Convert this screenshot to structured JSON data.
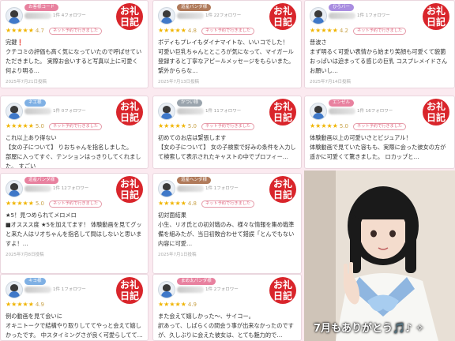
{
  "cards": [
    {
      "badge": "お客様コード",
      "seal_top": "お礼",
      "seal_bottom": "日記",
      "meta": "1件 4フォロワー",
      "rating_num": "4.7",
      "tag": "ネット予約で行きました",
      "body": "完鍵❗️\nクチコミの評価も高く気になっていたので呼ばせていただきました。 実際お会いすると写真以上に可愛く何より明る…",
      "date": "2025年7月21日投稿"
    },
    {
      "badge": "道産パンダ様",
      "seal_top": "お礼",
      "seal_bottom": "日記",
      "meta": "1件 22フォロワー",
      "rating_num": "4.8",
      "tag": "ネット予約で行きました",
      "body": "ボディもプレイもダイナマイトな、いいコでした！\n可愛い巨乳ちゃんとところが気になって、マイガール登録すると丁寧なアピールメッセージをもらいまた。緊外かららな…",
      "date": "2025年7月13日投稿"
    },
    {
      "badge": "ひろバー",
      "seal_top": "お礼",
      "seal_bottom": "日記",
      "meta": "1件 1フォロワー",
      "rating_num": "4.2",
      "tag": "ネット予約で行きました",
      "body": "普波さ\nまず明るく可愛い表情から始まり笑顔も可愛くて貌菌 おっぱいは迫まってる感じの巨乳 コスプレメイドさんお願いし…",
      "date": "2025年7月14日投稿"
    },
    {
      "badge": "ネエ様",
      "seal_top": "お礼",
      "seal_bottom": "日記",
      "meta": "1件 0フォロワー",
      "rating_num": "5.0",
      "tag": "ネット予約で行きました",
      "body": "これ以上あり得ない\n【女の子について】 りおちゃんを指名しました。\n部屋に入ってすぐ、テンションはっきりしてくれました。 すごい",
      "date": ""
    },
    {
      "badge": "かつい様",
      "seal_top": "お礼",
      "seal_bottom": "日記",
      "meta": "1件 11フォロワー",
      "rating_num": "5.0",
      "tag": "ネット予約で行きました",
      "body": "初めてのお店は緊張します\n【女の子について】 女の子検索で好みの条件を入力して検索して表示されたキャストの中でプロフィー…",
      "date": ""
    },
    {
      "badge": "エンゼル",
      "seal_top": "お礼",
      "seal_bottom": "日記",
      "meta": "1件 16フォロワー",
      "rating_num": "5.0",
      "tag": "ネット予約で行きました",
      "body": "体験動画以上の可愛いさとビジュアル！\n体験動画で見ていた容もも、実際に会った彼女の方が遥かに可愛くて驚きました。 ロカップと…",
      "date": ""
    },
    {
      "badge": "道産パンダ様",
      "seal_top": "お礼",
      "seal_bottom": "日記",
      "meta": "1件 12フォロワー",
      "rating_num": "5.0",
      "tag": "ネット予約で行きました",
      "body": "★5！見つめられてメロメロ\n■オススス度 ★5を加えてます！ 体験動画を見てグッと来た人はリオちゃんを指名して間はしないと思いますよ！…",
      "date": "2025年7月8日投稿"
    },
    {
      "badge": "道産ヘンダ様",
      "seal_top": "お礼",
      "seal_bottom": "日記",
      "meta": "1件 1フォロワー",
      "rating_num": "4.8",
      "tag": "ネット予約で行きました",
      "body": "初対面結果\n小生、リオ氏との初対戦のみ、様々な情報を集め戦準備を組みたが、当日初敗合わせて錯誤「とんでもない内容に可愛…",
      "date": "2025年7月1日投稿"
    },
    {
      "badge": "キヨ様",
      "seal_top": "お礼",
      "seal_bottom": "日記",
      "meta": "1件 1フォロワー",
      "rating_num": "4.9",
      "tag": "",
      "body": "例の動画を見て会いに\nオキニトークで結構やり取りしててやっと会えて嬉しかったです。 中スタイミングさが良く可愛らしてて…",
      "date": ""
    },
    {
      "badge": "まめ太パンダ様",
      "seal_top": "お礼",
      "seal_bottom": "日記",
      "meta": "1件 2フォロワー",
      "rating_num": "4.9",
      "tag": "",
      "body": "また会えて嬉しかった〜、サイコー。\n訳あって、しばらくの間会う事が出来なかったのですが、久しぶりに会えた彼女は、とても魅力的で…",
      "date": ""
    }
  ],
  "photo": {
    "caption": "7月もありがとう🎵♪ ✧"
  }
}
